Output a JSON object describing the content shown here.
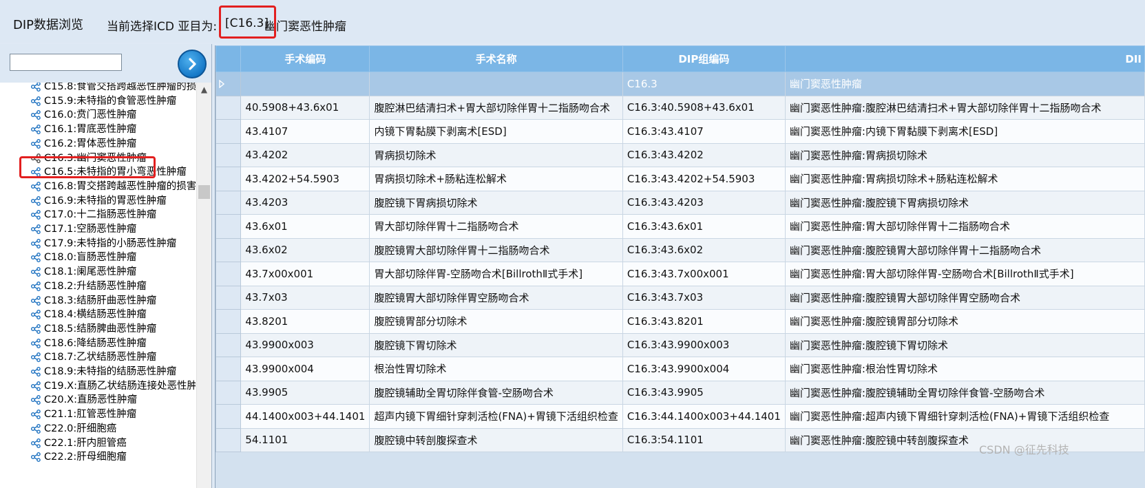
{
  "header": {
    "app_title": "DIP数据浏览",
    "icd_label": "当前选择ICD 亚目为:",
    "icd_code": "[C16.3]",
    "icd_name": "幽门窦恶性肿瘤"
  },
  "search": {
    "value": ""
  },
  "tree": {
    "items": [
      "C15.8:食管交搭跨越恶性肿瘤的损",
      "C15.9:未特指的食管恶性肿瘤",
      "C16.0:贲门恶性肿瘤",
      "C16.1:胃底恶性肿瘤",
      "C16.2:胃体恶性肿瘤",
      "C16.3:幽门窦恶性肿瘤",
      "C16.5:未特指的胃小弯恶性肿瘤",
      "C16.8:胃交搭跨越恶性肿瘤的损害",
      "C16.9:未特指的胃恶性肿瘤",
      "C17.0:十二指肠恶性肿瘤",
      "C17.1:空肠恶性肿瘤",
      "C17.9:未特指的小肠恶性肿瘤",
      "C18.0:盲肠恶性肿瘤",
      "C18.1:阑尾恶性肿瘤",
      "C18.2:升结肠恶性肿瘤",
      "C18.3:结肠肝曲恶性肿瘤",
      "C18.4:横结肠恶性肿瘤",
      "C18.5:结肠脾曲恶性肿瘤",
      "C18.6:降结肠恶性肿瘤",
      "C18.7:乙状结肠恶性肿瘤",
      "C18.9:未特指的结肠恶性肿瘤",
      "C19.X:直肠乙状结肠连接处恶性肿",
      "C20.X:直肠恶性肿瘤",
      "C21.1:肛管恶性肿瘤",
      "C22.0:肝细胞癌",
      "C22.1:肝内胆管癌",
      "C22.2:肝母细胞瘤"
    ],
    "selected_index": 5
  },
  "grid": {
    "columns": [
      "手术编码",
      "手术名称",
      "DIP组编码",
      "DII"
    ],
    "rows": [
      [
        "",
        "",
        "C16.3",
        "幽门窦恶性肿瘤"
      ],
      [
        "40.5908+43.6x01",
        "腹腔淋巴结清扫术+胃大部切除伴胃十二指肠吻合术",
        "C16.3:40.5908+43.6x01",
        "幽门窦恶性肿瘤:腹腔淋巴结清扫术+胃大部切除伴胃十二指肠吻合术"
      ],
      [
        "43.4107",
        "内镜下胃黏膜下剥离术[ESD]",
        "C16.3:43.4107",
        "幽门窦恶性肿瘤:内镜下胃黏膜下剥离术[ESD]"
      ],
      [
        "43.4202",
        "胃病损切除术",
        "C16.3:43.4202",
        "幽门窦恶性肿瘤:胃病损切除术"
      ],
      [
        "43.4202+54.5903",
        "胃病损切除术+肠粘连松解术",
        "C16.3:43.4202+54.5903",
        "幽门窦恶性肿瘤:胃病损切除术+肠粘连松解术"
      ],
      [
        "43.4203",
        "腹腔镜下胃病损切除术",
        "C16.3:43.4203",
        "幽门窦恶性肿瘤:腹腔镜下胃病损切除术"
      ],
      [
        "43.6x01",
        "胃大部切除伴胃十二指肠吻合术",
        "C16.3:43.6x01",
        "幽门窦恶性肿瘤:胃大部切除伴胃十二指肠吻合术"
      ],
      [
        "43.6x02",
        "腹腔镜胃大部切除伴胃十二指肠吻合术",
        "C16.3:43.6x02",
        "幽门窦恶性肿瘤:腹腔镜胃大部切除伴胃十二指肠吻合术"
      ],
      [
        "43.7x00x001",
        "胃大部切除伴胃-空肠吻合术[BillrothⅡ式手术]",
        "C16.3:43.7x00x001",
        "幽门窦恶性肿瘤:胃大部切除伴胃-空肠吻合术[BillrothⅡ式手术]"
      ],
      [
        "43.7x03",
        "腹腔镜胃大部切除伴胃空肠吻合术",
        "C16.3:43.7x03",
        "幽门窦恶性肿瘤:腹腔镜胃大部切除伴胃空肠吻合术"
      ],
      [
        "43.8201",
        "腹腔镜胃部分切除术",
        "C16.3:43.8201",
        "幽门窦恶性肿瘤:腹腔镜胃部分切除术"
      ],
      [
        "43.9900x003",
        "腹腔镜下胃切除术",
        "C16.3:43.9900x003",
        "幽门窦恶性肿瘤:腹腔镜下胃切除术"
      ],
      [
        "43.9900x004",
        "根治性胃切除术",
        "C16.3:43.9900x004",
        "幽门窦恶性肿瘤:根治性胃切除术"
      ],
      [
        "43.9905",
        "腹腔镜辅助全胃切除伴食管-空肠吻合术",
        "C16.3:43.9905",
        "幽门窦恶性肿瘤:腹腔镜辅助全胃切除伴食管-空肠吻合术"
      ],
      [
        "44.1400x003+44.1401",
        "超声内镜下胃细针穿刺活检(FNA)+胃镜下活组织检查",
        "C16.3:44.1400x003+44.1401",
        "幽门窦恶性肿瘤:超声内镜下胃细针穿刺活检(FNA)+胃镜下活组织检查"
      ],
      [
        "54.1101",
        "腹腔镜中转剖腹探查术",
        "C16.3:54.1101",
        "幽门窦恶性肿瘤:腹腔镜中转剖腹探查术"
      ]
    ],
    "selected_row": 0
  },
  "watermark": "CSDN @征先科技",
  "colors": {
    "highlight": "#e21f1f",
    "header_bg": "#7bb6e6",
    "selected_row": "#a8c8e6",
    "tree_icon": "#1a6fbf"
  }
}
